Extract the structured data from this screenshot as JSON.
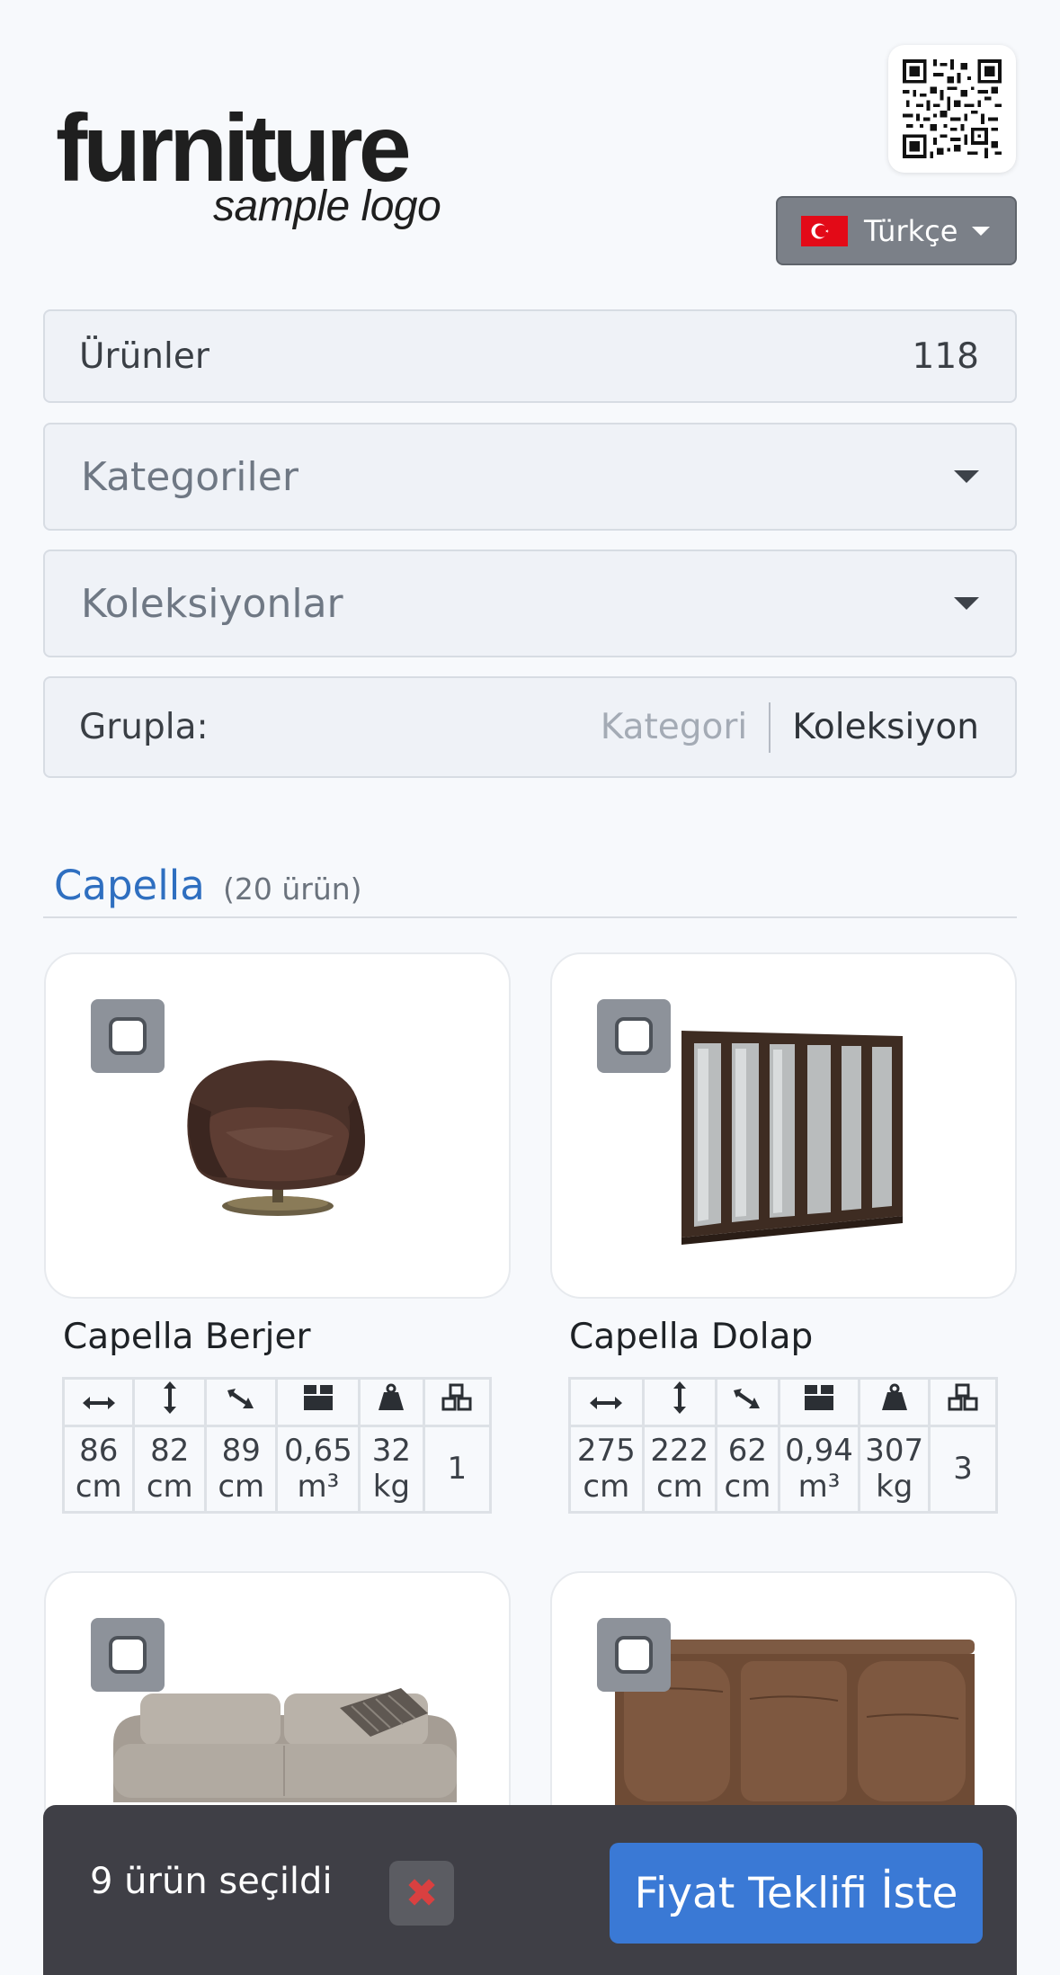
{
  "header": {
    "logo_main": "furniture",
    "logo_sub": "sample logo",
    "language": "Türkçe",
    "qr_icon": "qr-code-icon",
    "flag_icon": "turkey-flag-icon"
  },
  "filters": {
    "products_label": "Ürünler",
    "products_count": "118",
    "categories_placeholder": "Kategoriler",
    "collections_placeholder": "Koleksiyonlar",
    "group_label": "Grupla:",
    "group_options": [
      "Kategori",
      "Koleksiyon"
    ],
    "group_selected": "Koleksiyon"
  },
  "section": {
    "title": "Capella",
    "count": "(20 ürün)"
  },
  "spec_icons": [
    "width-arrow-icon",
    "height-arrow-icon",
    "depth-arrow-icon",
    "box-volume-icon",
    "weight-icon",
    "packages-icon"
  ],
  "products": [
    {
      "name": "Capella Berjer",
      "image": "armchair",
      "specs": [
        "86\ncm",
        "82\ncm",
        "89\ncm",
        "0,65\nm³",
        "32\nkg",
        "1"
      ]
    },
    {
      "name": "Capella Dolap",
      "image": "wardrobe",
      "specs": [
        "275\ncm",
        "222\ncm",
        "62\ncm",
        "0,94\nm³",
        "307\nkg",
        "3"
      ]
    },
    {
      "name": "",
      "image": "sofa",
      "specs": []
    },
    {
      "name": "",
      "image": "sideboard",
      "specs": []
    }
  ],
  "selection_bar": {
    "selected_text": "9 ürün seçildi",
    "clear_icon": "close-icon",
    "clear_symbol": "✖",
    "quote_button": "Fiyat Teklifi İste"
  },
  "colors": {
    "accent": "#3a79d5",
    "section_title": "#2f6fc0",
    "bar_bg": "#3f3f46",
    "clear": "#d94040"
  }
}
